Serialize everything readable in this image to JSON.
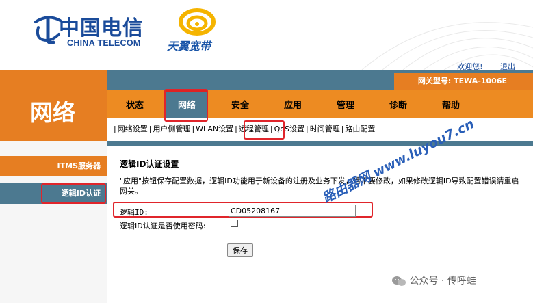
{
  "header": {
    "brand_cn": "中国电信",
    "brand_en": "CHINA TELECOM",
    "tianyi_text": "天翼宽带",
    "welcome": "欢迎您!",
    "logout": "退出"
  },
  "banner": {
    "section_title": "网络",
    "model_label": "网关型号: TEWA-1006E"
  },
  "tabs": [
    "状态",
    "网络",
    "安全",
    "应用",
    "管理",
    "诊断",
    "帮助"
  ],
  "active_tab": "网络",
  "subnav": [
    "网络设置",
    "用户侧管理",
    "WLAN设置",
    "远程管理",
    "QoS设置",
    "时间管理",
    "路由配置"
  ],
  "active_subnav": "远程管理",
  "sidebar": {
    "items": [
      "ITMS服务器",
      "逻辑ID认证"
    ],
    "active": "逻辑ID认证"
  },
  "form": {
    "title": "逻辑ID认证设置",
    "description": "\"应用\"按钮保存配置数据，逻辑ID功能用于新设备的注册及业务下发，请不要修改，如果修改逻辑ID导致配置错误请重启网关。",
    "logic_id_label": "逻辑ID:",
    "logic_id_value": "CD05208167",
    "use_password_label": "逻辑ID认证是否使用密码:",
    "use_password_checked": false,
    "save_label": "保存"
  },
  "watermark": "路由器网 www.luyou7.cn",
  "wechat_source": "公众号 · 传呼蛙",
  "colors": {
    "orange": "#e67e22",
    "steel_blue": "#4c7990",
    "highlight_red": "#e0252b",
    "telecom_blue": "#1a4b9a"
  }
}
